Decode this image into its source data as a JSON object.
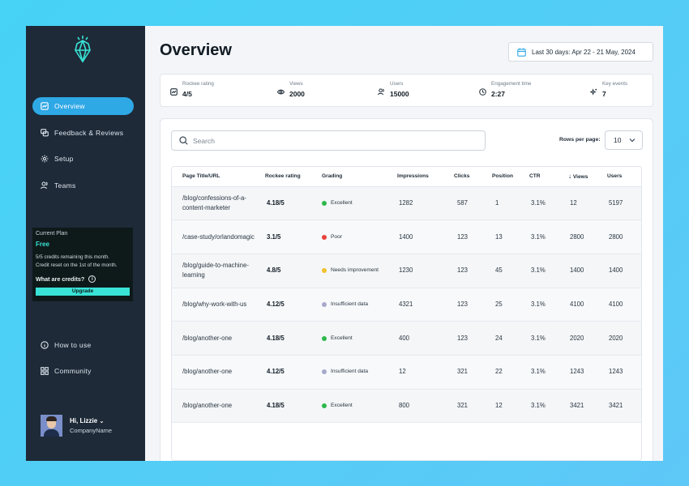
{
  "sidebar": {
    "nav": [
      {
        "label": "Overview",
        "icon": "chart-icon",
        "active": true
      },
      {
        "label": "Feedback & Reviews",
        "icon": "feedback-icon",
        "active": false
      },
      {
        "label": "Setup",
        "icon": "gear-icon",
        "active": false
      },
      {
        "label": "Teams",
        "icon": "users-icon",
        "active": false
      }
    ],
    "plan": {
      "title": "Current Plan",
      "name": "Free",
      "desc1": "5/5 credits remaining this month.",
      "desc2": "Credit reset on the 1st of the month.",
      "credits_link": "What are credits?",
      "upgrade_label": "Upgrade"
    },
    "bottom_nav": [
      {
        "label": "How to use",
        "icon": "info-icon"
      },
      {
        "label": "Community",
        "icon": "grid-icon"
      }
    ],
    "user": {
      "greeting": "Hi, Lizzie",
      "company": "CompanyName"
    }
  },
  "header": {
    "title": "Overview",
    "date_range": "Last 30 days: Apr 22 - 21 May, 2024"
  },
  "stats": [
    {
      "label": "Rockee rating",
      "value": "4/5"
    },
    {
      "label": "Views",
      "value": "2000"
    },
    {
      "label": "Users",
      "value": "15000"
    },
    {
      "label": "Engagement time",
      "value": "2:27"
    },
    {
      "label": "Key events",
      "value": "7"
    }
  ],
  "search": {
    "placeholder": "Search"
  },
  "rows_per_page": {
    "label": "Rows per page:",
    "value": "10"
  },
  "table": {
    "headers": [
      "Page Title/URL",
      "Rockee rating",
      "Grading",
      "Impressions",
      "Clicks",
      "Position",
      "CTR",
      "Views",
      "Users"
    ],
    "rows": [
      {
        "url": "/blog/confessions-of-a-content-marketer",
        "rating": "4.18/5",
        "grade": "Excellent",
        "grade_color": "#2db84b",
        "impressions": "1282",
        "clicks": "587",
        "position": "1",
        "ctr": "3.1%",
        "views": "12",
        "users": "5197"
      },
      {
        "url": "/case-study/orlandomagic",
        "rating": "3.1/5",
        "grade": "Poor",
        "grade_color": "#e8433a",
        "impressions": "1400",
        "clicks": "123",
        "position": "13",
        "ctr": "3.1%",
        "views": "2800",
        "users": "2800"
      },
      {
        "url": "/blog/guide-to-machine-learning",
        "rating": "4.8/5",
        "grade": "Needs improvement",
        "grade_color": "#f2c12e",
        "impressions": "1230",
        "clicks": "123",
        "position": "45",
        "ctr": "3.1%",
        "views": "1400",
        "users": "1400"
      },
      {
        "url": "/blog/why-work-with-us",
        "rating": "4.12/5",
        "grade": "Insufficient data",
        "grade_color": "#a7a9c9",
        "impressions": "4321",
        "clicks": "123",
        "position": "25",
        "ctr": "3.1%",
        "views": "4100",
        "users": "4100"
      },
      {
        "url": "/blog/another-one",
        "rating": "4.18/5",
        "grade": "Excellent",
        "grade_color": "#2db84b",
        "impressions": "400",
        "clicks": "123",
        "position": "24",
        "ctr": "3.1%",
        "views": "2020",
        "users": "2020"
      },
      {
        "url": "/blog/another-one",
        "rating": "4.12/5",
        "grade": "Insufficient data",
        "grade_color": "#a7a9c9",
        "impressions": "12",
        "clicks": "321",
        "position": "22",
        "ctr": "3.1%",
        "views": "1243",
        "users": "1243"
      },
      {
        "url": "/blog/another-one",
        "rating": "4.18/5",
        "grade": "Excellent",
        "grade_color": "#2db84b",
        "impressions": "800",
        "clicks": "321",
        "position": "12",
        "ctr": "3.1%",
        "views": "3421",
        "users": "3421"
      }
    ]
  },
  "colors": {
    "accent": "#2fa8e6",
    "sidebar": "#1e2a38",
    "plan_accent": "#39e3d6",
    "background": "#46d3f5"
  }
}
